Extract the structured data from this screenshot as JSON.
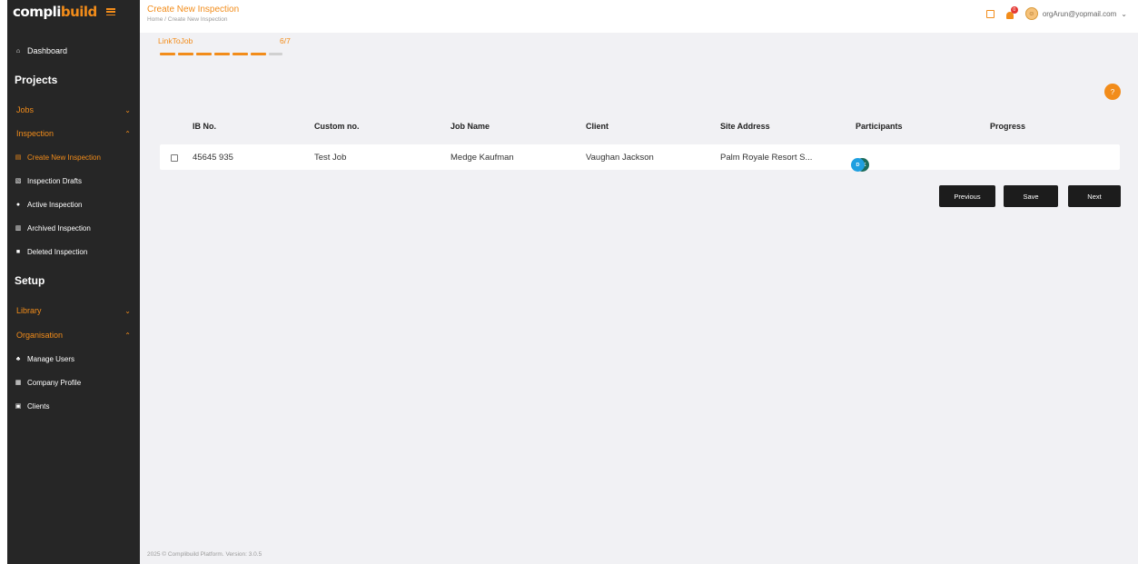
{
  "brand": {
    "logo_part1": "compli",
    "logo_part2": "build",
    "accent": "#f28c1a"
  },
  "sidebar": {
    "dashboard": "Dashboard",
    "projects_title": "Projects",
    "jobs": "Jobs",
    "inspection": "Inspection",
    "inspection_items": [
      {
        "label": "Create New Inspection",
        "icon": "document-icon"
      },
      {
        "label": "Inspection Drafts",
        "icon": "drafts-icon"
      },
      {
        "label": "Active Inspection",
        "icon": "active-icon"
      },
      {
        "label": "Archived Inspection",
        "icon": "archive-icon"
      },
      {
        "label": "Deleted Inspection",
        "icon": "trash-icon"
      }
    ],
    "setup_title": "Setup",
    "library": "Library",
    "organisation": "Organisation",
    "organisation_items": [
      {
        "label": "Manage Users",
        "icon": "users-icon"
      },
      {
        "label": "Company Profile",
        "icon": "building-icon"
      },
      {
        "label": "Clients",
        "icon": "clients-icon"
      }
    ]
  },
  "header": {
    "title": "Create New Inspection",
    "breadcrumb": "Home / Create New Inspection",
    "user_email": "orgArun@yopmail.com",
    "notification_count": "0"
  },
  "stepper": {
    "label": "LinkToJob",
    "count": "6/7",
    "progress_fraction": 0.857
  },
  "fab_label": "?",
  "table": {
    "columns": [
      "IB No.",
      "Custom no.",
      "Job Name",
      "Client",
      "Site Address",
      "Participants",
      "Progress"
    ],
    "rows": [
      {
        "ib_no": "45645 935",
        "custom_no": "Test Job",
        "job_name": "Medge Kaufman",
        "client": "Vaughan Jackson",
        "site_address": "Palm Royale Resort S...",
        "participants": [
          "OK",
          "D"
        ]
      }
    ]
  },
  "buttons": {
    "previous": "Previous",
    "save": "Save",
    "next": "Next"
  },
  "footer": "2025 © Complibuild Platform. Version: 3.0.5"
}
